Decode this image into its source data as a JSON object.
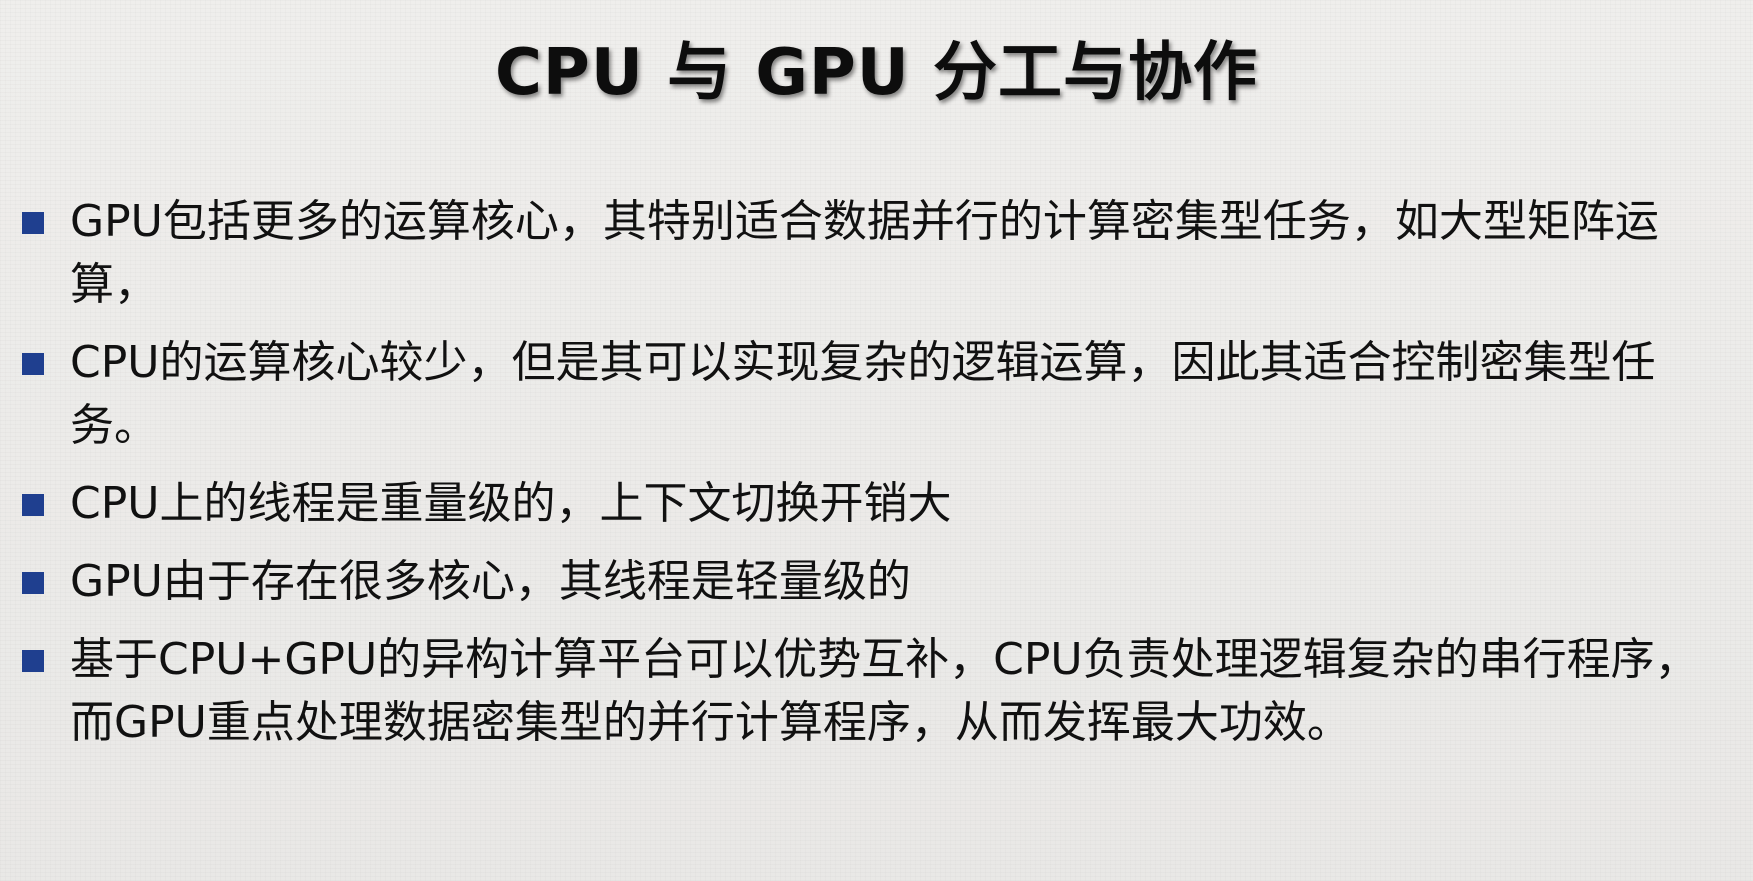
{
  "slide": {
    "title": "CPU 与 GPU 分工与协作",
    "bullets": [
      {
        "text": "GPU包括更多的运算核心，其特别适合数据并行的计算密集型任务，如大型矩阵运算，"
      },
      {
        "text": "CPU的运算核心较少，但是其可以实现复杂的逻辑运算，因此其适合控制密集型任务。"
      },
      {
        "text": "CPU上的线程是重量级的，上下文切换开销大"
      },
      {
        "text": "GPU由于存在很多核心，其线程是轻量级的"
      },
      {
        "text": "基于CPU+GPU的异构计算平台可以优势互补，CPU负责处理逻辑复杂的串行程序，而GPU重点处理数据密集型的并行计算程序，从而发挥最大功效。"
      }
    ]
  },
  "colors": {
    "bullet_marker": "#1f3f8f",
    "text": "#111111",
    "background": "#ecebea"
  },
  "icons": {
    "bullet_marker": "square-bullet-icon"
  }
}
